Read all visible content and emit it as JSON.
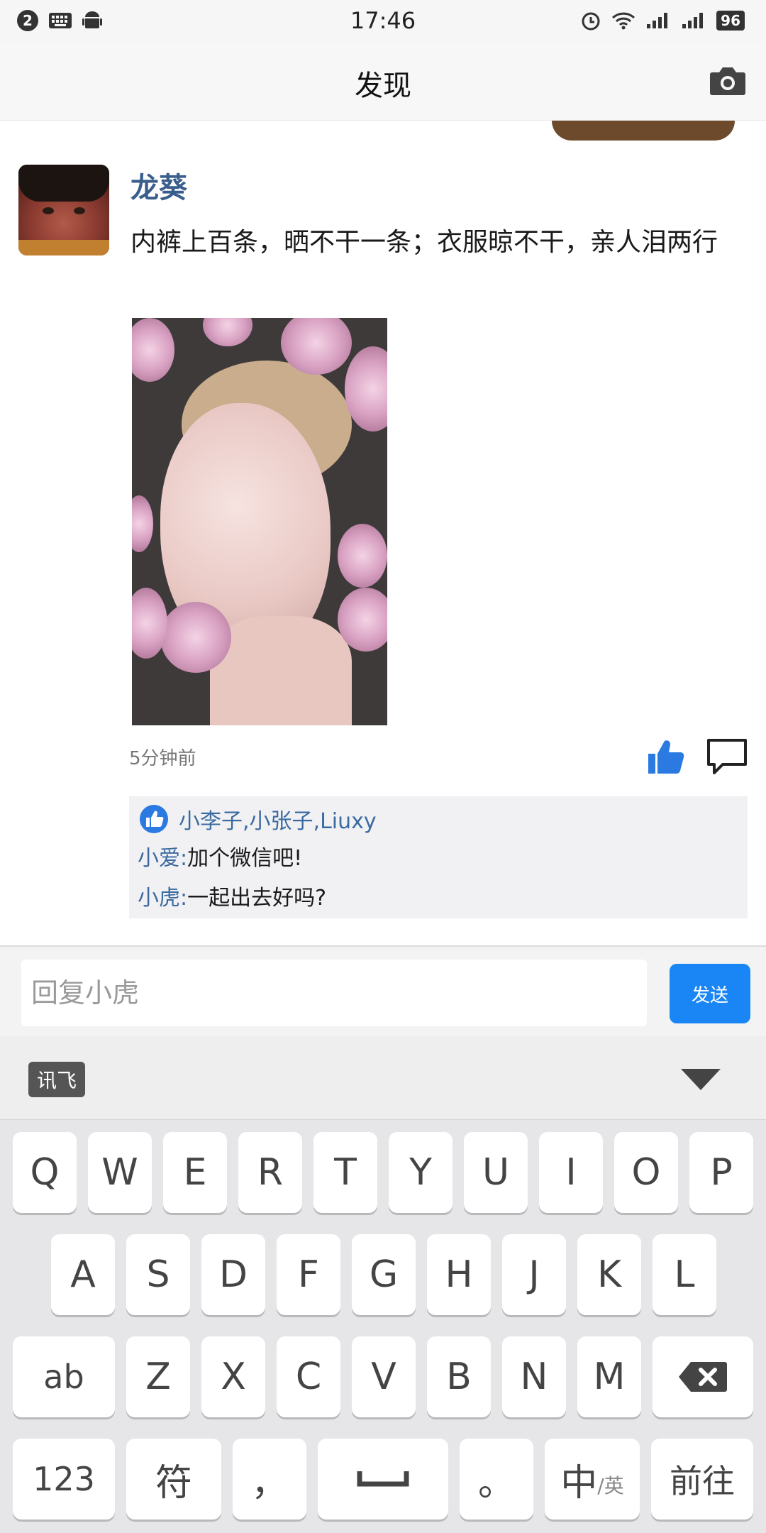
{
  "status_bar": {
    "notification_count": "2",
    "time": "17:46",
    "battery": "96",
    "icons": [
      "keyboard-icon",
      "android-icon",
      "alarm-icon",
      "wifi-icon",
      "signal-icon",
      "signal-icon-2"
    ]
  },
  "header": {
    "title": "发现",
    "camera_icon": "camera-icon"
  },
  "post": {
    "author": "龙葵",
    "text": "内裤上百条，晒不干一条；衣服晾不干，亲人泪两行",
    "time": "5分钟前",
    "likes": {
      "names": "小李子,小张子,Liuxy"
    },
    "comments": [
      {
        "user": "小爱",
        "sep": ":",
        "text": "加个微信吧!"
      },
      {
        "user": "小虎",
        "sep": ":",
        "text": "一起出去好吗?"
      }
    ]
  },
  "reply": {
    "placeholder": "回复小虎",
    "send_label": "发送"
  },
  "keyboard": {
    "ime_label": "讯飞",
    "row1": [
      "Q",
      "W",
      "E",
      "R",
      "T",
      "Y",
      "U",
      "I",
      "O",
      "P"
    ],
    "row2": [
      "A",
      "S",
      "D",
      "F",
      "G",
      "H",
      "J",
      "K",
      "L"
    ],
    "row3": [
      "ab",
      "Z",
      "X",
      "C",
      "V",
      "B",
      "N",
      "M"
    ],
    "row4": {
      "num": "123",
      "symbol": "符",
      "comma": "，",
      "period": "。",
      "lang_main": "中",
      "lang_sub": "/英",
      "go": "前往"
    }
  },
  "colors": {
    "accent_blue": "#1a86f5",
    "name_blue": "#3a6aa0"
  }
}
